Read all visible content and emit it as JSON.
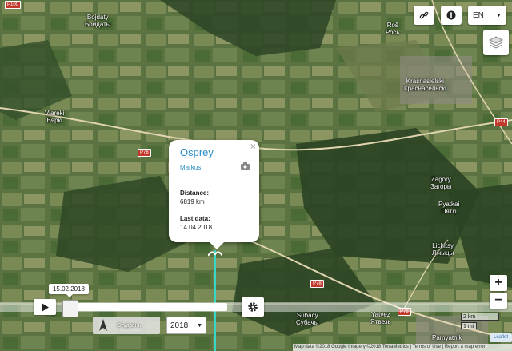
{
  "colors": {
    "accent": "#2b8cc4",
    "track": "#38d6c6",
    "road_label": "#c0392b"
  },
  "map": {
    "places": [
      {
        "id": "bojdaty",
        "lat_name": "Bojdaty",
        "cyr_name": "Бойдаты"
      },
      {
        "id": "rosh",
        "lat_name": "Roš",
        "cyr_name": "Рось"
      },
      {
        "id": "krasnasielski",
        "lat_name": "Krasnasielski",
        "cyr_name": "Краснасельскі"
      },
      {
        "id": "viareki",
        "lat_name": "Viarеki",
        "cyr_name": "Вяркі"
      },
      {
        "id": "zagory",
        "lat_name": "Zagory",
        "cyr_name": "Загоры"
      },
      {
        "id": "pyatkai",
        "lat_name": "Pyatkai",
        "cyr_name": "Пяткі"
      },
      {
        "id": "lichitsy",
        "lat_name": "Lichitsy",
        "cyr_name": "Лічыцы"
      },
      {
        "id": "subacy",
        "lat_name": "Subačy",
        "cyr_name": "Субачы"
      },
      {
        "id": "yatvez",
        "lat_name": "Yatvez",
        "cyr_name": "Ятвезь"
      },
      {
        "id": "pamyatnik",
        "lat_name": "Pamyatnik",
        "cyr_name": ""
      }
    ],
    "roads": [
      "P100",
      "P78",
      "P78",
      "P78",
      "P44"
    ]
  },
  "toolbar": {
    "link_icon": "link-icon",
    "info_icon": "info-icon",
    "language": "EN"
  },
  "popup": {
    "title": "Osprey",
    "author": "Markus",
    "close": "×",
    "distance_label": "Distance:",
    "distance_value": "6819 km",
    "last_data_label": "Last data:",
    "last_data_value": "14.04.2018"
  },
  "timeline": {
    "current_date": "15.02.2018",
    "year": "2018",
    "wheel_text": "Студзень"
  },
  "scale": {
    "top": "2 km",
    "bottom": "1 mi"
  },
  "attribution": "Map data ©2018 Google Imagery ©2018 TerraMetrics | Terms of Use | Report a map error",
  "leaflet": "Leaflet"
}
